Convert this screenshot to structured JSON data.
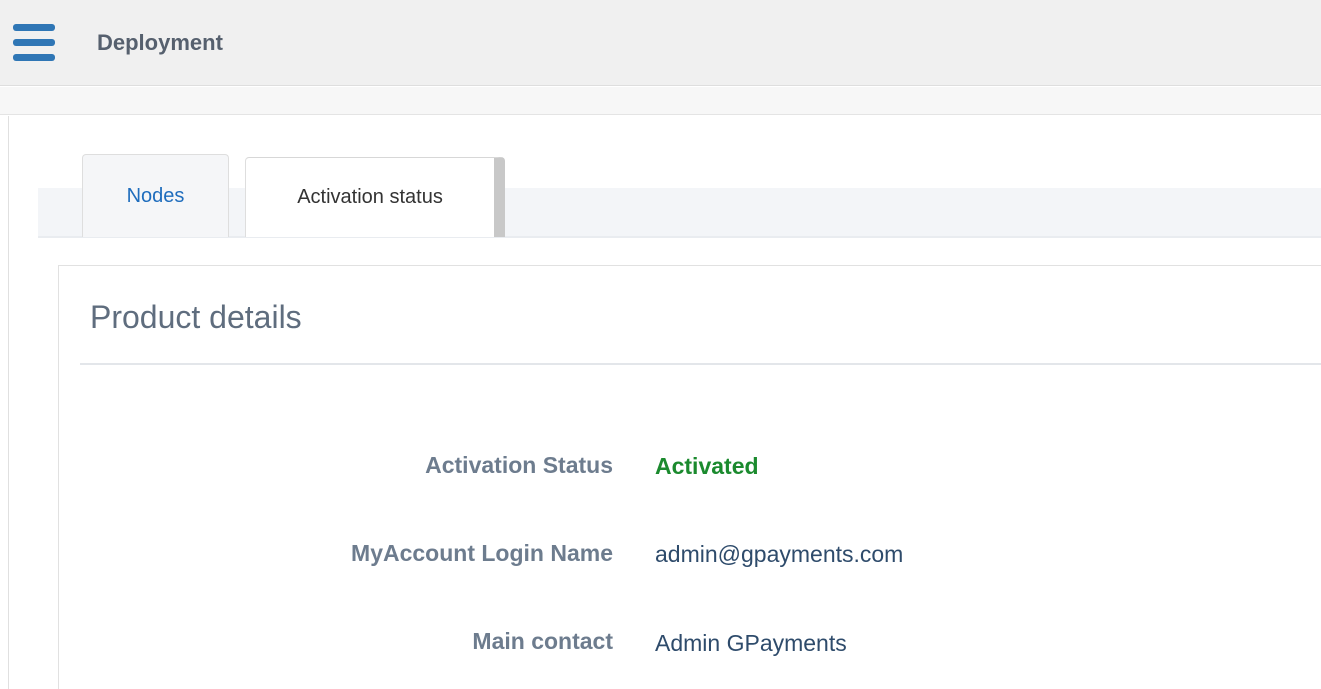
{
  "header": {
    "title": "Deployment"
  },
  "tabs": [
    {
      "label": "Nodes",
      "active": false
    },
    {
      "label": "Activation status",
      "active": true
    }
  ],
  "panel": {
    "title": "Product details",
    "rows": [
      {
        "label": "Activation Status",
        "value": "Activated",
        "value_color": "#1b8a2e"
      },
      {
        "label": "MyAccount Login Name",
        "value": "admin@gpayments.com"
      },
      {
        "label": "Main contact",
        "value": "Admin GPayments"
      }
    ]
  },
  "colors": {
    "accent": "#2f76b5",
    "link": "#1f6dbd",
    "status_ok": "#1b8a2e"
  }
}
